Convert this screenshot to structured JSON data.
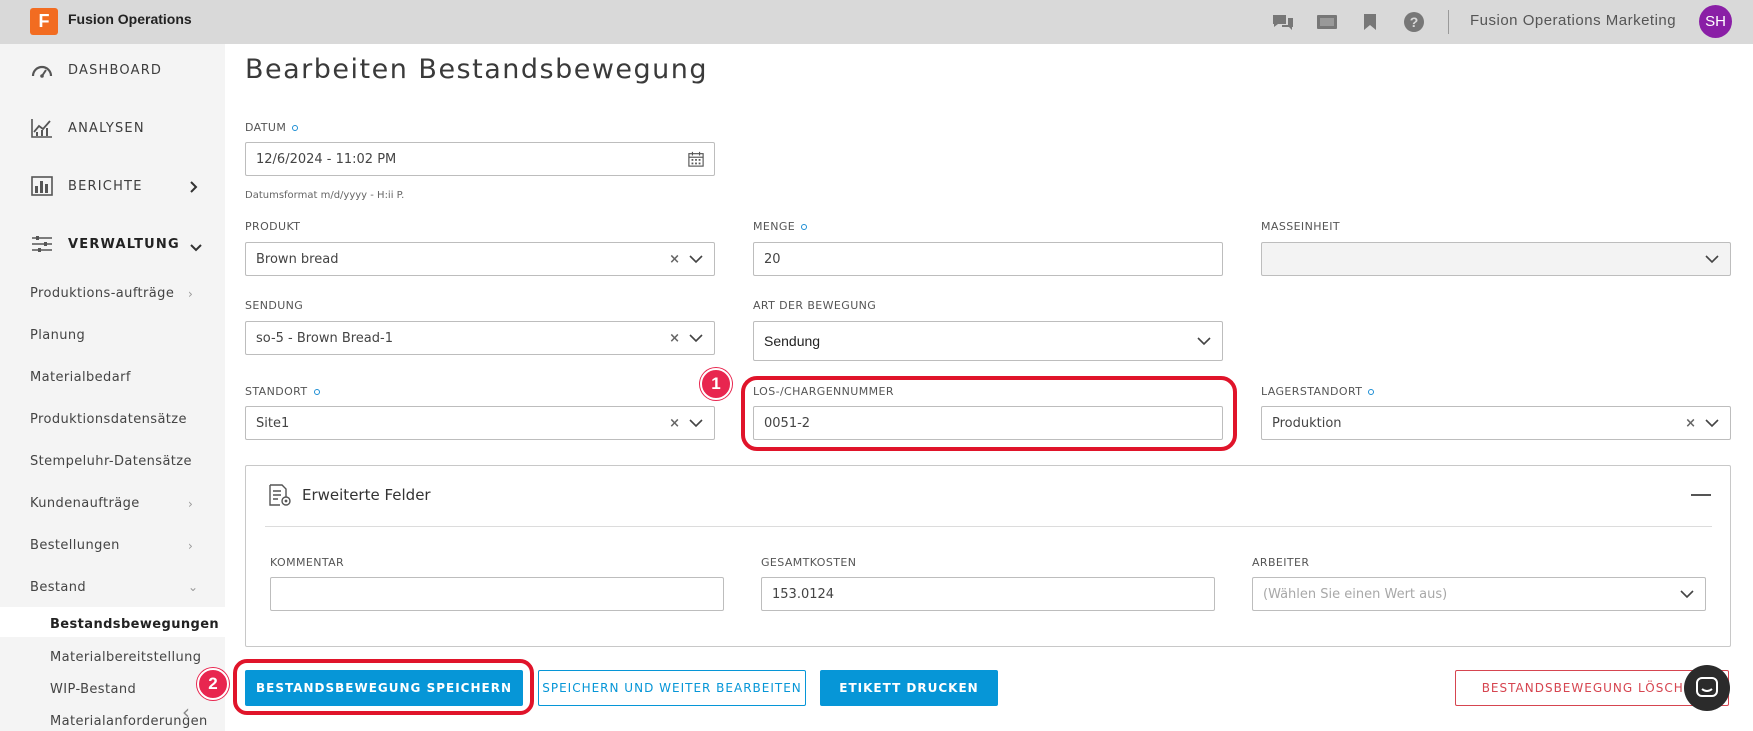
{
  "app": {
    "logo_letter": "F",
    "title": "Fusion Operations",
    "org_name": "Fusion Operations Marketing",
    "avatar_initials": "SH"
  },
  "sidebar": {
    "main": [
      {
        "label": "DASHBOARD",
        "icon": "dashboard-gauge-icon"
      },
      {
        "label": "ANALYSEN",
        "icon": "line-chart-icon"
      },
      {
        "label": "BERICHTE",
        "icon": "bar-chart-icon"
      },
      {
        "label": "VERWALTUNG",
        "icon": "sliders-icon"
      }
    ],
    "sub": [
      "Produktions-aufträge",
      "Planung",
      "Materialbedarf",
      "Produktionsdatensätze",
      "Stempeluhr-Datensätze",
      "Kundenaufträge",
      "Bestellungen",
      "Bestand"
    ],
    "sub2": [
      "Bestandsbewegungen",
      "Materialbereitstellung",
      "WIP-Bestand",
      "Materialanforderungen"
    ]
  },
  "page": {
    "title": "Bearbeiten Bestandsbewegung"
  },
  "form": {
    "datum": {
      "label": "DATUM",
      "value": "12/6/2024 - 11:02 PM",
      "hint": "Datumsformat m/d/yyyy - H:ii P."
    },
    "produkt": {
      "label": "PRODUKT",
      "value": "Brown bread"
    },
    "menge": {
      "label": "MENGE",
      "value": "20"
    },
    "masseinheit": {
      "label": "MASSEINHEIT",
      "value": ""
    },
    "sendung": {
      "label": "SENDUNG",
      "value": "so-5 - Brown Bread-1"
    },
    "art": {
      "label": "ART DER BEWEGUNG",
      "value": "Sendung"
    },
    "standort": {
      "label": "STANDORT",
      "value": "Site1"
    },
    "los": {
      "label": "LOS-/CHARGENNUMMER",
      "value": "0051-2"
    },
    "lager": {
      "label": "LAGERSTANDORT",
      "value": "Produktion"
    }
  },
  "extended": {
    "title": "Erweiterte Felder",
    "kommentar": {
      "label": "KOMMENTAR",
      "value": ""
    },
    "gesamtkosten": {
      "label": "GESAMTKOSTEN",
      "value": "153.0124"
    },
    "arbeiter": {
      "label": "ARBEITER",
      "placeholder": "(Wählen Sie einen Wert aus)"
    }
  },
  "buttons": {
    "save": "BESTANDSBEWEGUNG SPEICHERN",
    "save_continue": "SPEICHERN UND WEITER BEARBEITEN",
    "print": "ETIKETT DRUCKEN",
    "delete": "BESTANDSBEWEGUNG LÖSCHEN"
  },
  "callouts": [
    "1",
    "2"
  ],
  "colors": {
    "accent": "#0696d7",
    "callout": "#e0142a",
    "brand": "#f26c21",
    "avatar": "#8a1fa6"
  }
}
